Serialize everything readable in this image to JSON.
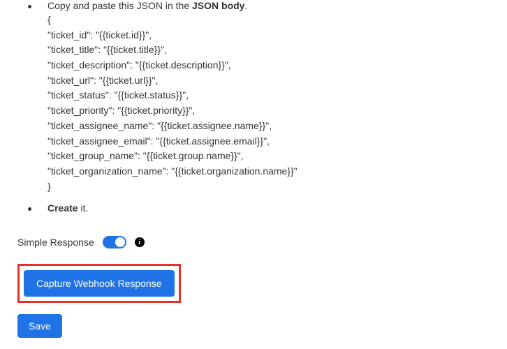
{
  "instructions": {
    "copy_paste_prefix": "Copy and paste this JSON in the ",
    "copy_paste_bold": "JSON body",
    "copy_paste_suffix": ".",
    "create_bold": "Create",
    "create_suffix": " it."
  },
  "json_lines": [
    "{",
    "\"ticket_id\": \"{{ticket.id}}\",",
    "\"ticket_title\": \"{{ticket.title}}\",",
    "\"ticket_description\": \"{{ticket.description}}\",",
    "\"ticket_url\": \"{{ticket.url}}\",",
    "\"ticket_status\": \"{{ticket.status}}\",",
    "\"ticket_priority\": \"{{ticket.priority}}\",",
    "\"ticket_assignee_name\": \"{{ticket.assignee.name}}\",",
    "\"ticket_assignee_email\": \"{{ticket.assignee.email}}\",",
    "\"ticket_group_name\": \"{{ticket.group.name}}\",",
    "\"ticket_organization_name\": \"{{ticket.organization.name}}\"",
    "}"
  ],
  "toggle": {
    "label": "Simple Response",
    "info_glyph": "i"
  },
  "buttons": {
    "capture_webhook": "Capture Webhook Response",
    "save": "Save"
  }
}
